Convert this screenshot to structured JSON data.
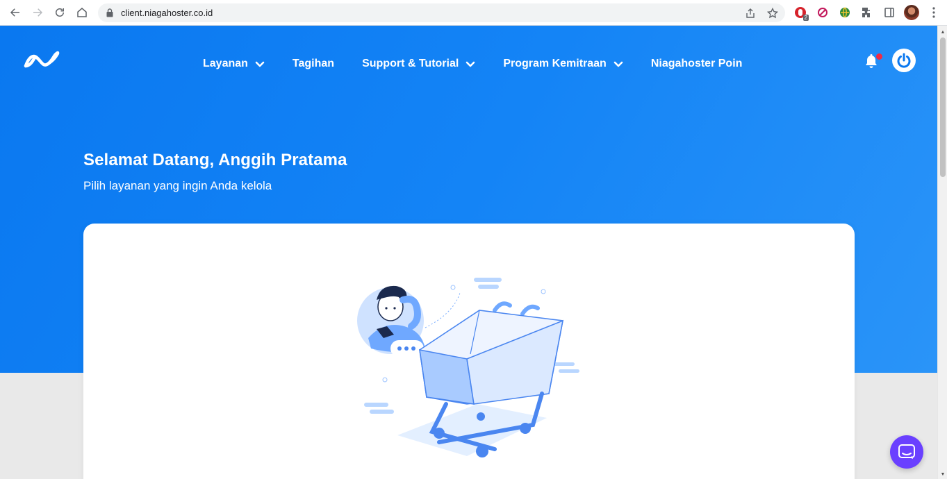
{
  "browser": {
    "url": "client.niagahoster.co.id",
    "extension_badge": "2",
    "icons": [
      "back-icon",
      "forward-icon",
      "reload-icon",
      "home-icon",
      "lock-icon",
      "share-icon",
      "star-icon",
      "extensions-icon",
      "sidepanel-icon",
      "menu-icon"
    ]
  },
  "nav": {
    "items": [
      {
        "label": "Layanan",
        "has_dropdown": true
      },
      {
        "label": "Tagihan",
        "has_dropdown": false
      },
      {
        "label": "Support & Tutorial",
        "has_dropdown": true
      },
      {
        "label": "Program Kemitraan",
        "has_dropdown": true
      },
      {
        "label": "Niagahoster Poin",
        "has_dropdown": false
      }
    ]
  },
  "hero": {
    "title": "Selamat Datang, Anggih Pratama",
    "subtitle": "Pilih layanan yang ingin Anda kelola"
  },
  "colors": {
    "hero_blue": "#0a78f0",
    "chat_purple": "#6a40ff",
    "notification_red": "#f02b45"
  }
}
